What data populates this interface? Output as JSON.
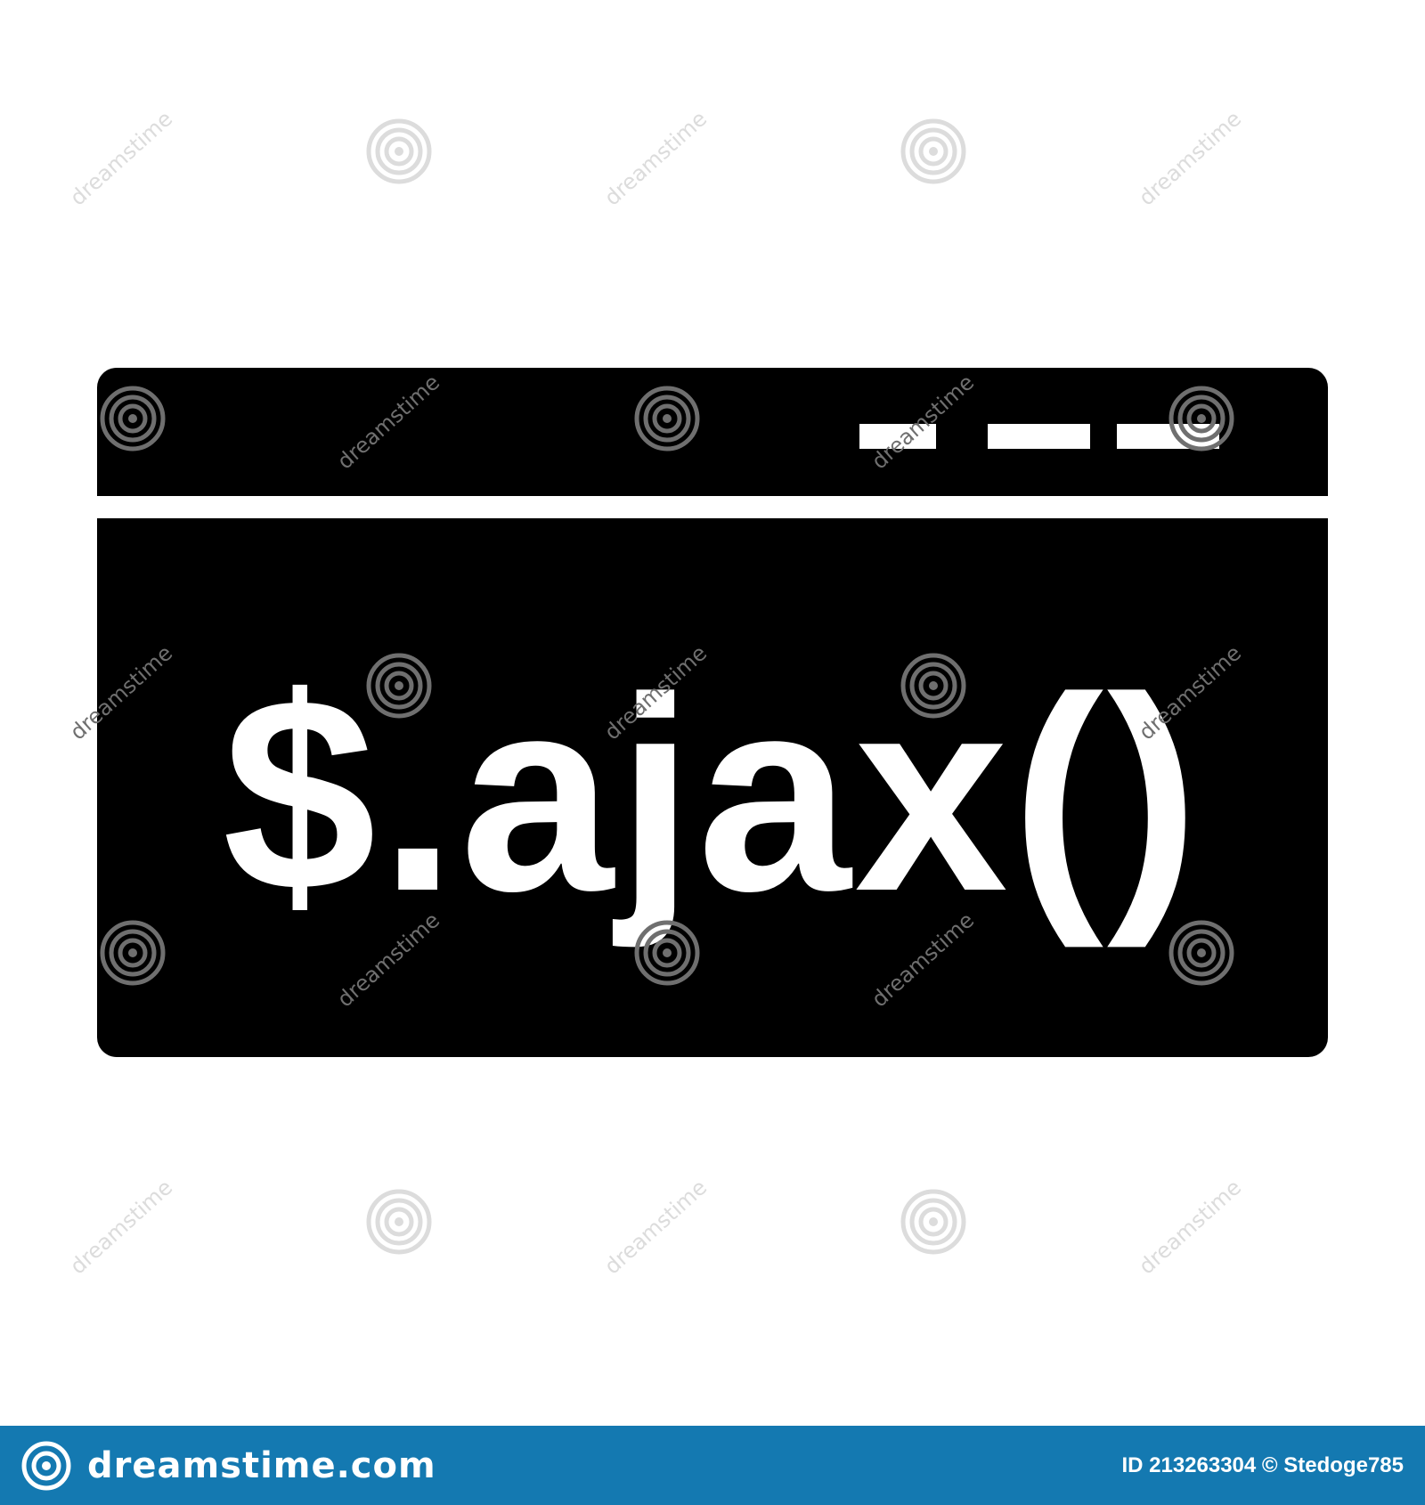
{
  "code_label": "$.ajax()",
  "watermark": {
    "text": "dreamstime",
    "spiral_icon": "spiral-icon"
  },
  "footer": {
    "brand": "dreamstime.com",
    "credit": "ID 213263304 © Stedoge785",
    "logo_icon": "dreamstime-spiral-icon"
  },
  "colors": {
    "window": "#000000",
    "background": "#ffffff",
    "code_text": "#ffffff",
    "footer_bar": "#1479b1",
    "watermark_dark": "#6f6f6f",
    "watermark_light": "#dcdcdc"
  }
}
